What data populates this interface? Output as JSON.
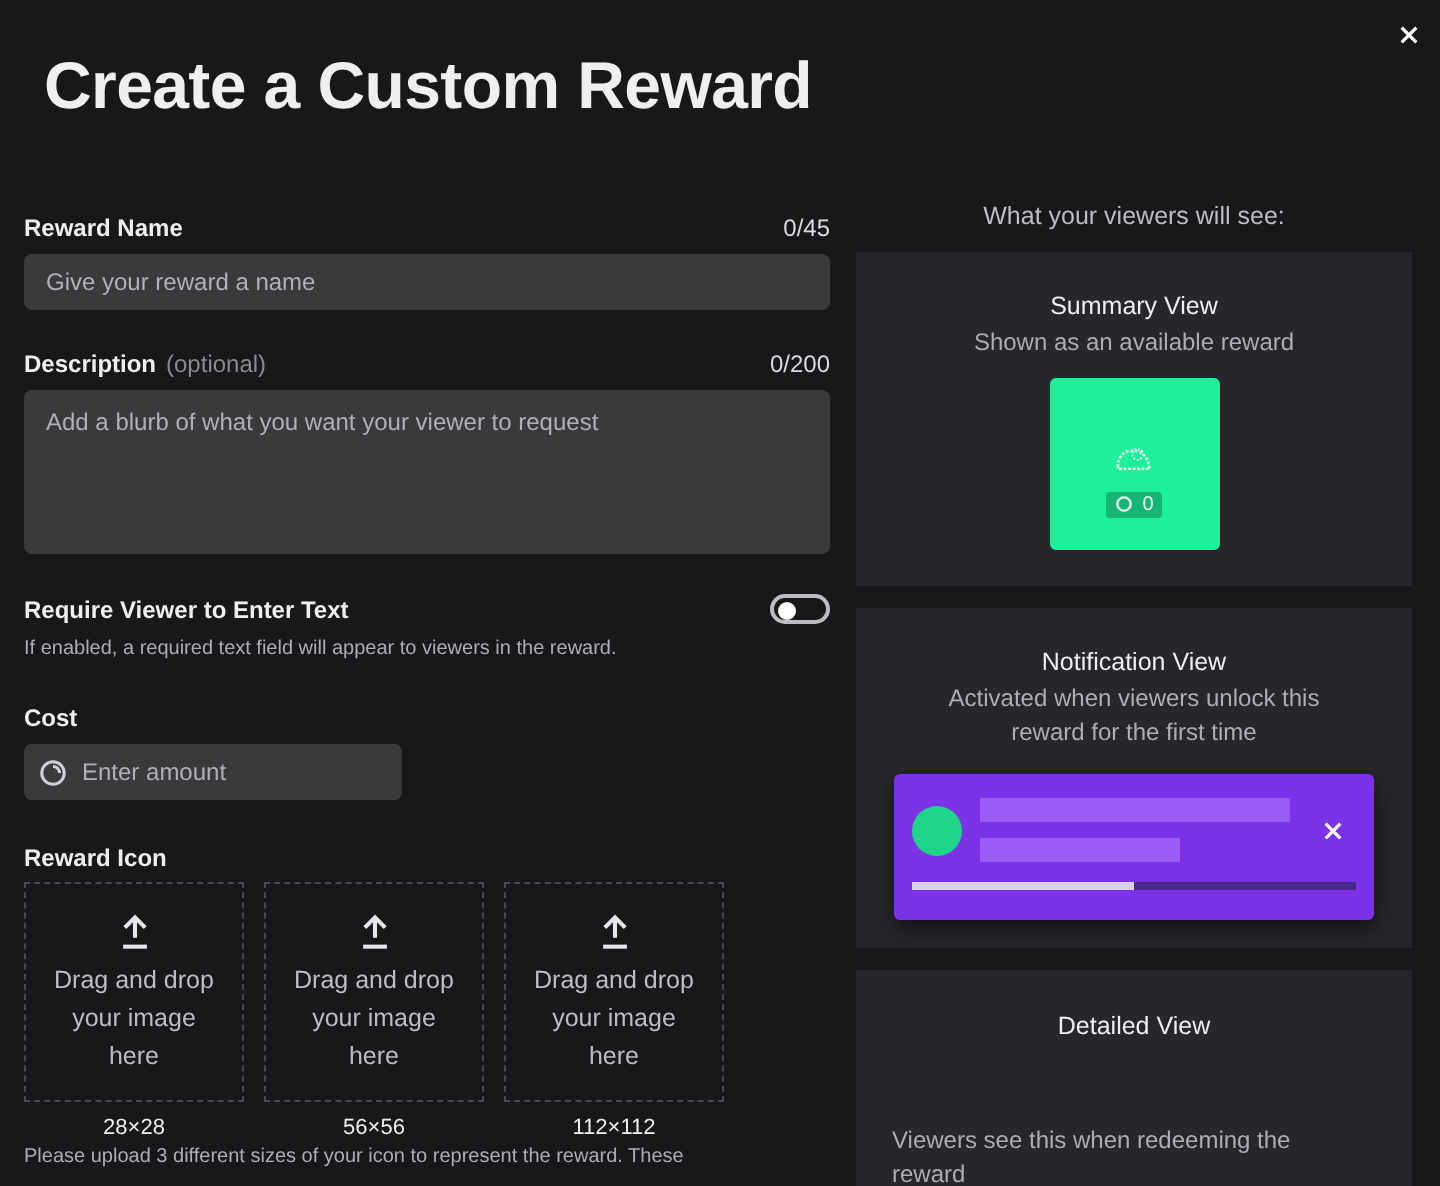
{
  "window": {
    "title": "Create a Custom Reward"
  },
  "form": {
    "reward_name": {
      "label": "Reward Name",
      "counter": "0/45",
      "placeholder": "Give your reward a name"
    },
    "description": {
      "label": "Description",
      "optional": "(optional)",
      "counter": "0/200",
      "placeholder": "Add a blurb of what you want your viewer to request"
    },
    "require_text": {
      "label": "Require Viewer to Enter Text",
      "help": "If enabled, a required text field will appear to viewers in the reward.",
      "on": false
    },
    "cost": {
      "label": "Cost",
      "placeholder": "Enter amount"
    },
    "reward_icon": {
      "label": "Reward Icon",
      "zones": [
        {
          "text": "Drag and drop your image here",
          "size": "28×28"
        },
        {
          "text": "Drag and drop your image here",
          "size": "56×56"
        },
        {
          "text": "Drag and drop your image here",
          "size": "112×112"
        }
      ],
      "note": "Please upload 3 different sizes of your icon to represent the reward. These"
    }
  },
  "preview": {
    "heading": "What your viewers will see:",
    "summary": {
      "title": "Summary View",
      "subtitle": "Shown as an available reward",
      "count": "0"
    },
    "notification": {
      "title": "Notification View",
      "subtitle": "Activated when viewers unlock this reward for the first time",
      "level": 0.5
    },
    "detailed": {
      "title": "Detailed View",
      "subtitle": "Viewers see this when redeeming the reward"
    }
  }
}
